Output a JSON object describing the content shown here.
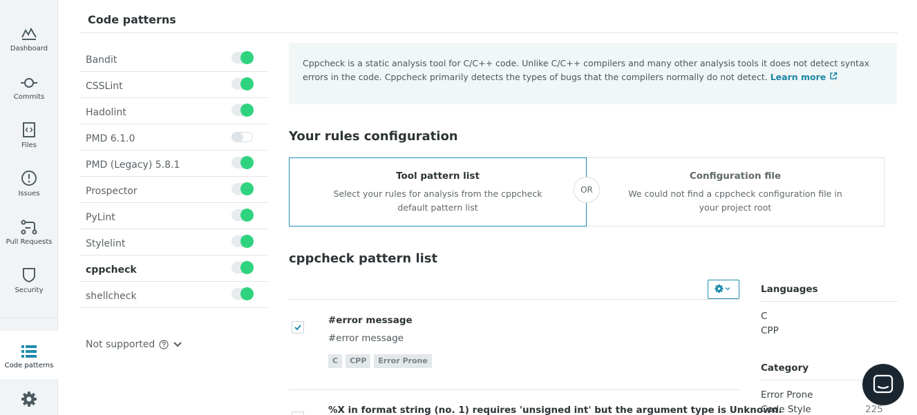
{
  "nav": {
    "dashboard": "Dashboard",
    "commits": "Commits",
    "files": "Files",
    "issues": "Issues",
    "pull_requests": "Pull Requests",
    "security": "Security",
    "code_patterns": "Code patterns"
  },
  "header": {
    "title": "Code patterns"
  },
  "tools": [
    {
      "name": "Bandit",
      "enabled": true
    },
    {
      "name": "CSSLint",
      "enabled": true
    },
    {
      "name": "Hadolint",
      "enabled": true
    },
    {
      "name": "PMD 6.1.0",
      "enabled": false
    },
    {
      "name": "PMD (Legacy) 5.8.1",
      "enabled": true
    },
    {
      "name": "Prospector",
      "enabled": true
    },
    {
      "name": "PyLint",
      "enabled": true
    },
    {
      "name": "Stylelint",
      "enabled": true
    },
    {
      "name": "cppcheck",
      "enabled": true,
      "selected": true
    },
    {
      "name": "shellcheck",
      "enabled": true
    }
  ],
  "not_supported": "Not supported",
  "info": {
    "text": "Cppcheck is a static analysis tool for C/C++ code. Unlike C/C++ compilers and many other analysis tools it does not detect syntax errors in the code. Cppcheck primarily detects the types of bugs that the compilers normally do not detect.",
    "link": "Learn more"
  },
  "rules_config": {
    "title": "Your rules configuration",
    "pattern_card": {
      "title": "Tool pattern list",
      "desc": "Select your rules for analysis from the cppcheck default pattern list"
    },
    "or_label": "OR",
    "file_card": {
      "title": "Configuration file",
      "desc": "We could not find a cppcheck configuration file in your project root"
    }
  },
  "pattern_list": {
    "title": "cppcheck pattern list",
    "patterns": [
      {
        "title": "#error message",
        "desc": "#error message",
        "tags": [
          "C",
          "CPP",
          "Error Prone"
        ],
        "checked": true
      },
      {
        "title": "%X in format string (no. 1) requires 'unsigned int' but the argument type is Unknown.",
        "checked": false
      }
    ]
  },
  "filters": {
    "languages_title": "Languages",
    "languages": [
      "C",
      "CPP"
    ],
    "category_title": "Category",
    "categories": [
      {
        "name": "Error Prone",
        "count": ""
      },
      {
        "name": "Code Style",
        "count": "225"
      }
    ]
  },
  "colors": {
    "accent": "#1f8cad",
    "toggle_on": "#2fd37f",
    "info_bg": "#f1f6f6"
  }
}
